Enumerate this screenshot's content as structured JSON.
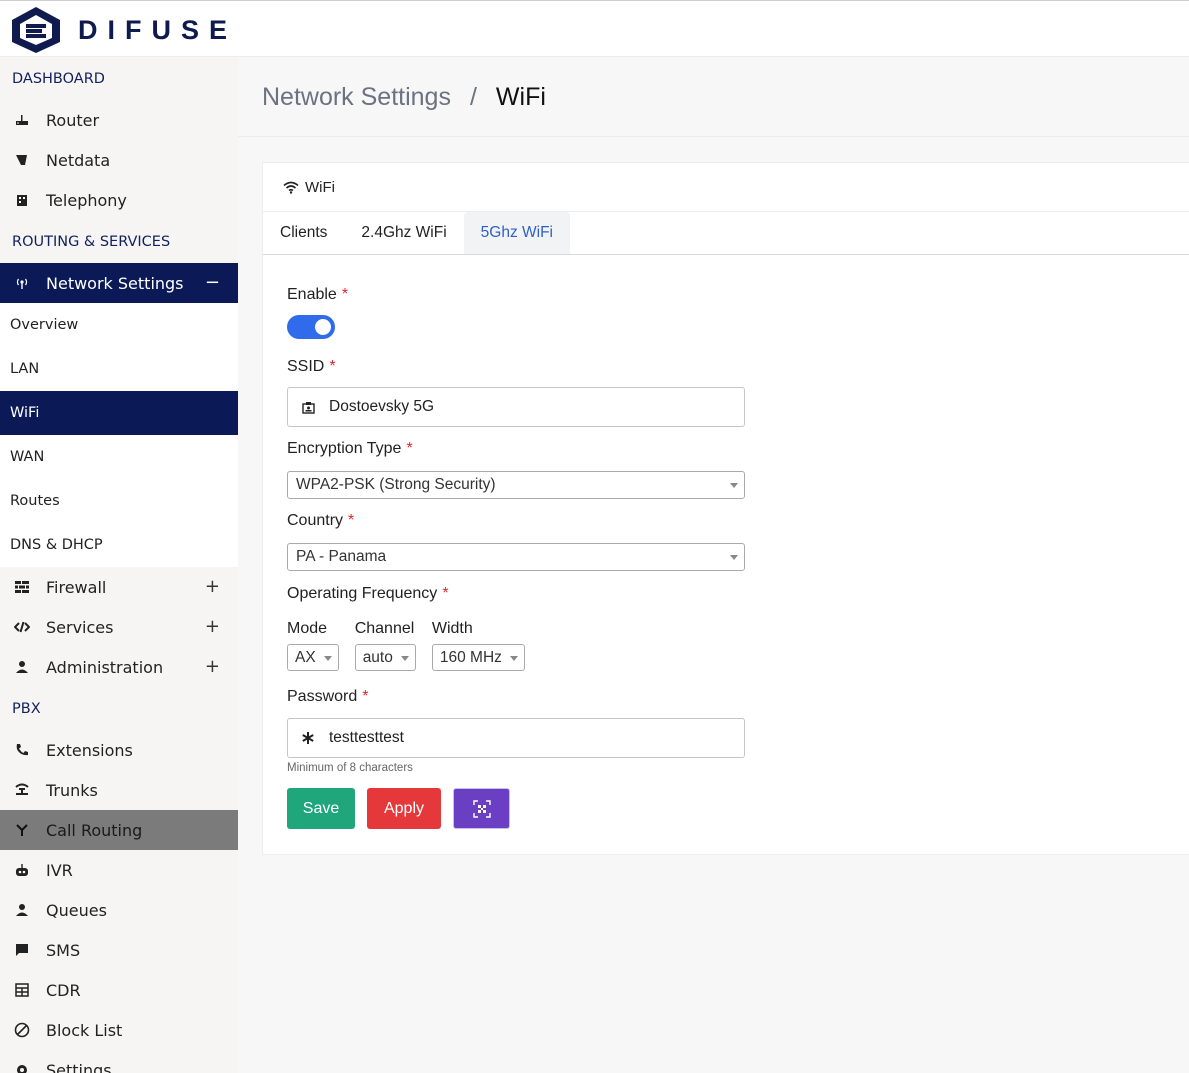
{
  "brand": {
    "name": "DIFUSE"
  },
  "sidebar": {
    "sections": {
      "dashboard": "DASHBOARD",
      "routing": "ROUTING & SERVICES",
      "pbx": "PBX"
    },
    "dashboard_items": [
      {
        "label": "Router",
        "icon": "router-icon"
      },
      {
        "label": "Netdata",
        "icon": "netdata-icon"
      },
      {
        "label": "Telephony",
        "icon": "telephony-icon"
      }
    ],
    "network_settings": {
      "label": "Network Settings",
      "toggle": "−",
      "icon": "antenna-icon"
    },
    "network_sub": [
      "Overview",
      "LAN",
      "WiFi",
      "WAN",
      "Routes",
      "DNS & DHCP"
    ],
    "routing_items": [
      {
        "label": "Firewall",
        "toggle": "+",
        "icon": "firewall-icon"
      },
      {
        "label": "Services",
        "toggle": "+",
        "icon": "services-icon"
      },
      {
        "label": "Administration",
        "toggle": "+",
        "icon": "admin-icon"
      }
    ],
    "pbx_items": [
      {
        "label": "Extensions",
        "icon": "phone-icon"
      },
      {
        "label": "Trunks",
        "icon": "trunk-icon"
      },
      {
        "label": "Call Routing",
        "icon": "call-routing-icon"
      },
      {
        "label": "IVR",
        "icon": "ivr-icon"
      },
      {
        "label": "Queues",
        "icon": "queue-icon"
      },
      {
        "label": "SMS",
        "icon": "sms-icon"
      },
      {
        "label": "CDR",
        "icon": "cdr-icon"
      },
      {
        "label": "Block List",
        "icon": "block-icon"
      },
      {
        "label": "Settings",
        "icon": "settings-icon"
      }
    ]
  },
  "breadcrumb": {
    "parent": "Network Settings",
    "separator": "/",
    "current": "WiFi"
  },
  "card": {
    "title": "WiFi",
    "tabs": [
      "Clients",
      "2.4Ghz WiFi",
      "5Ghz WiFi"
    ],
    "active_tab": "5Ghz WiFi"
  },
  "form": {
    "enable": {
      "label": "Enable",
      "required": "*",
      "value": "on"
    },
    "ssid": {
      "label": "SSID",
      "required": "*",
      "value": "Dostoevsky 5G"
    },
    "encryption": {
      "label": "Encryption Type",
      "required": "*",
      "value": "WPA2-PSK (Strong Security)"
    },
    "country": {
      "label": "Country",
      "required": "*",
      "value": "PA - Panama"
    },
    "frequency": {
      "label": "Operating Frequency",
      "required": "*",
      "mode_label": "Mode",
      "mode": "AX",
      "channel_label": "Channel",
      "channel": "auto",
      "width_label": "Width",
      "width": "160 MHz"
    },
    "password": {
      "label": "Password",
      "required": "*",
      "value": "testtesttest",
      "help": "Minimum of 8 characters"
    },
    "buttons": {
      "save": "Save",
      "apply": "Apply"
    }
  },
  "colors": {
    "nav_active": "#0b1a57",
    "accent": "#2f6bea",
    "save": "#1fa67a",
    "apply": "#e5383b",
    "qr": "#6a3fc4",
    "required": "#e0262f"
  }
}
